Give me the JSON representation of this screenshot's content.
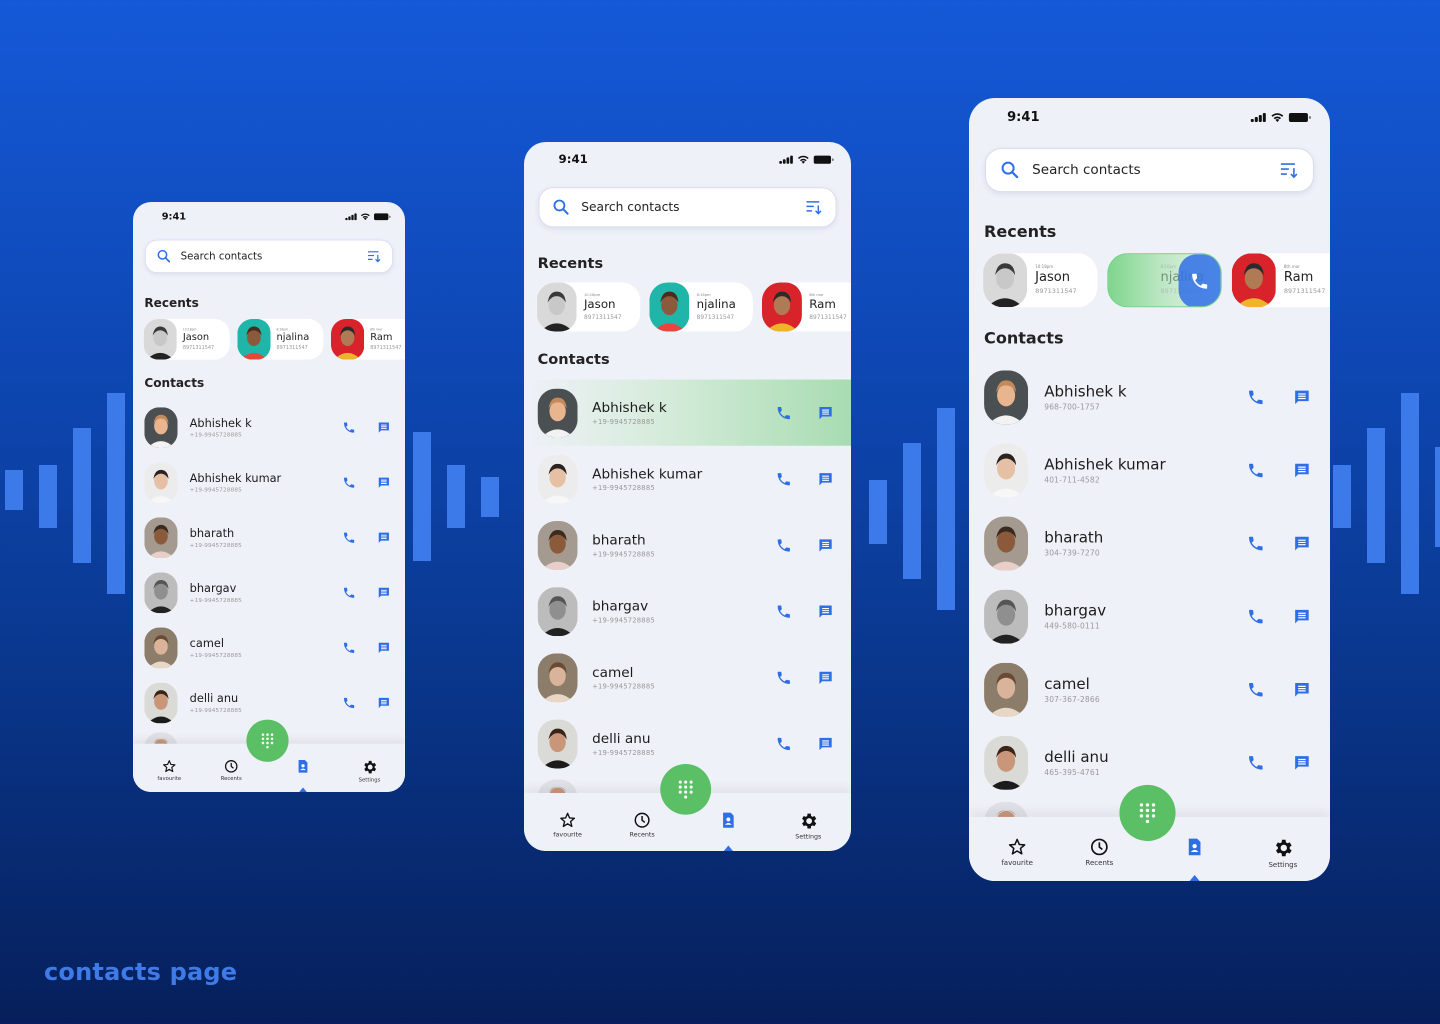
{
  "page_title": "contacts page",
  "colors": {
    "accent_blue": "#2f6fe6",
    "fab_green": "#5abf65",
    "background_top": "#1559d8",
    "background_bottom": "#061f5a",
    "bar_blue": "#3b7ae8"
  },
  "phones": [
    {
      "variant": "default",
      "status_time": "9:41",
      "search": {
        "placeholder": "Search contacts"
      },
      "recents_title": "Recents",
      "recents": [
        {
          "name": "Jason",
          "time": "10:18pm",
          "number": "8971311547",
          "state": "normal"
        },
        {
          "name": "njalina",
          "time": "8:16pm",
          "number": "8971311547",
          "state": "normal"
        },
        {
          "name": "Ram",
          "time": "8th mar",
          "number": "8971311547",
          "state": "normal"
        }
      ],
      "contacts_title": "Contacts",
      "contacts": [
        {
          "name": "Abhishek k",
          "number": "+19-9945728885"
        },
        {
          "name": "Abhishek kumar",
          "number": "+19-9945728885"
        },
        {
          "name": "bharath",
          "number": "+19-9945728885"
        },
        {
          "name": "bhargav",
          "number": "+19-9945728885"
        },
        {
          "name": "camel",
          "number": "+19-9945728885"
        },
        {
          "name": "delli anu",
          "number": "+19-9945728885"
        }
      ],
      "highlighted_contact": -1
    },
    {
      "variant": "contact-swipe",
      "status_time": "9:41",
      "search": {
        "placeholder": "Search contacts"
      },
      "recents_title": "Recents",
      "recents": [
        {
          "name": "Jason",
          "time": "10:18pm",
          "number": "8971311547",
          "state": "normal"
        },
        {
          "name": "njalina",
          "time": "8:16pm",
          "number": "8971311547",
          "state": "normal"
        },
        {
          "name": "Ram",
          "time": "8th mar",
          "number": "8971311547",
          "state": "normal"
        }
      ],
      "contacts_title": "Contacts",
      "contacts": [
        {
          "name": "Abhishek k",
          "number": "+19-9945728885"
        },
        {
          "name": "Abhishek kumar",
          "number": "+19-9945728885"
        },
        {
          "name": "bharath",
          "number": "+19-9945728885"
        },
        {
          "name": "bhargav",
          "number": "+19-9945728885"
        },
        {
          "name": "camel",
          "number": "+19-9945728885"
        },
        {
          "name": "delli anu",
          "number": "+19-9945728885"
        }
      ],
      "highlighted_contact": 0
    },
    {
      "variant": "recent-swipe",
      "status_time": "9:41",
      "search": {
        "placeholder": "Search contacts"
      },
      "recents_title": "Recents",
      "recents": [
        {
          "name": "Jason",
          "time": "10:18pm",
          "number": "8971311547",
          "state": "normal"
        },
        {
          "name": "njalina",
          "time": "8:16pm",
          "number": "8971311547",
          "state": "swiped"
        },
        {
          "name": "Ram",
          "time": "8th mar",
          "number": "8971311547",
          "state": "normal"
        }
      ],
      "contacts_title": "Contacts",
      "contacts": [
        {
          "name": "Abhishek k",
          "number": "968-700-1757"
        },
        {
          "name": "Abhishek kumar",
          "number": "401-711-4582"
        },
        {
          "name": "bharath",
          "number": "304-739-7270"
        },
        {
          "name": "bhargav",
          "number": "449-580-0111"
        },
        {
          "name": "camel",
          "number": "307-367-2866"
        },
        {
          "name": "delli anu",
          "number": "465-395-4761"
        }
      ],
      "highlighted_contact": -1
    }
  ],
  "bottom_nav": [
    {
      "label": "favourite",
      "icon": "star-icon",
      "active": false
    },
    {
      "label": "Recents",
      "icon": "clock-icon",
      "active": false
    },
    {
      "label": "",
      "icon": "contacts-icon",
      "active": true
    },
    {
      "label": "Settings",
      "icon": "gear-icon",
      "active": false
    }
  ],
  "fab": {
    "icon": "dialpad-icon"
  }
}
